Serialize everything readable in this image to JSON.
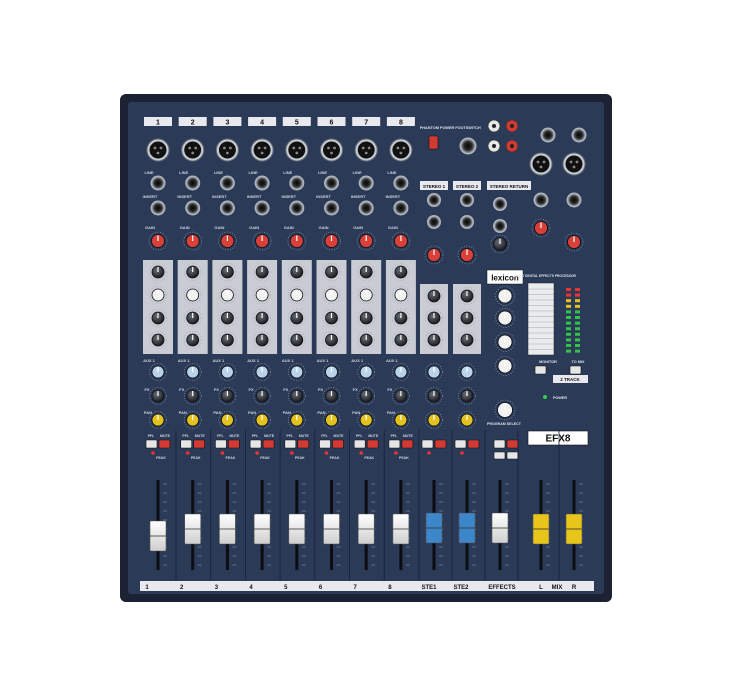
{
  "channels": [
    "1",
    "2",
    "3",
    "4",
    "5",
    "6",
    "7",
    "8"
  ],
  "bottom_labels": [
    "1",
    "2",
    "3",
    "4",
    "5",
    "6",
    "7",
    "8",
    "STE1",
    "STE2",
    "EFFECTS",
    "L",
    "MIX",
    "R"
  ],
  "section_labels": {
    "phantom": "PHANTOM POWER",
    "footswitch": "FOOTSWITCH",
    "stereo1": "STEREO 1",
    "stereo2": "STEREO 2",
    "stereo_return": "STEREO RETURN",
    "lexicon": "lexicon",
    "fx_title": "24-BIT DIGITAL EFFECTS PROCESSOR",
    "monitor": "MONITOR",
    "to_mix": "TO MIX",
    "two_track": "2 TRACK",
    "power": "POWER",
    "program_select": "PROGRAM SELECT",
    "efx": "EFX8"
  },
  "strip_text": {
    "line": "LINE",
    "insert": "INSERT",
    "gain": "GAIN",
    "aux1": "AUX 1",
    "fx": "FX",
    "pan": "PAN",
    "pfl": "PFL",
    "mute": "MUTE",
    "peak": "PEAK"
  },
  "colors": {
    "panel": "#2b3a57",
    "panel_dark": "#1f2b44",
    "eq_section": "#c9ccd2",
    "gain_knob": "#d8403a",
    "pan_knob": "#e3c21f",
    "aux_knob": "#b9d3ea",
    "fader_white": "#eeeeee",
    "fader_blue": "#3d86c9",
    "fader_yellow": "#e8c51b"
  }
}
